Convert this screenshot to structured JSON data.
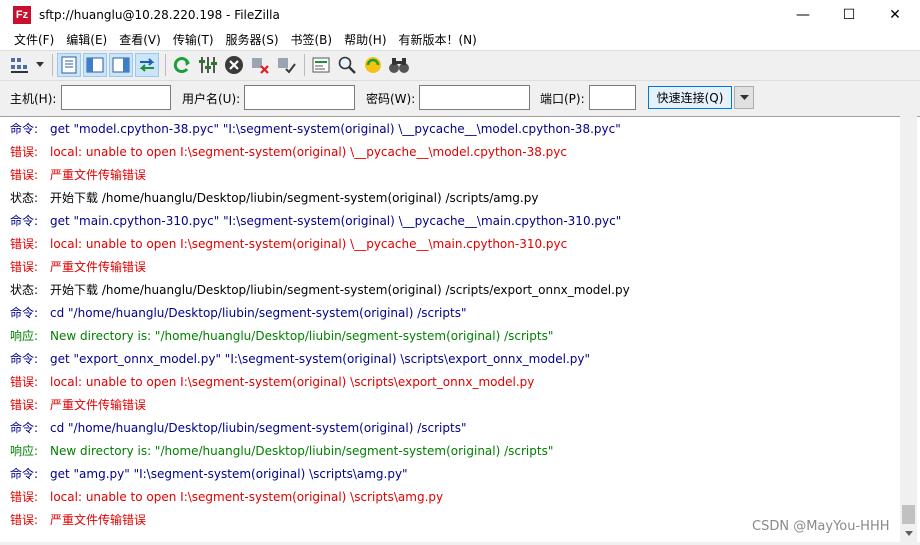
{
  "window": {
    "title": "sftp://huanglu@10.28.220.198 - FileZilla",
    "icon_letter": "Fz",
    "min_glyph": "—",
    "max_glyph": "☐",
    "close_glyph": "✕"
  },
  "menu": [
    "文件(F)",
    "编辑(E)",
    "查看(V)",
    "传输(T)",
    "服务器(S)",
    "书签(B)",
    "帮助(H)",
    "有新版本！(N)"
  ],
  "quickconnect": {
    "host_label": "主机(H):",
    "host_value": "",
    "user_label": "用户名(U):",
    "user_value": "",
    "pass_label": "密码(W):",
    "pass_value": "",
    "port_label": "端口(P):",
    "port_value": "",
    "connect_button": "快速连接(Q)"
  },
  "colors": {
    "command": "#00008b",
    "error": "#e00000",
    "status": "#000000",
    "response": "#008000"
  },
  "log": [
    {
      "type": "命令:",
      "kind": "command",
      "text": "get \"model.cpython-38.pyc\" \"I:\\segment-system(original) \\__pycache__\\model.cpython-38.pyc\""
    },
    {
      "type": "错误:",
      "kind": "error",
      "text": "local: unable to open I:\\segment-system(original) \\__pycache__\\model.cpython-38.pyc"
    },
    {
      "type": "错误:",
      "kind": "error",
      "text": "严重文件传输错误"
    },
    {
      "type": "状态:",
      "kind": "status",
      "text": "开始下载 /home/huanglu/Desktop/liubin/segment-system(original) /scripts/amg.py"
    },
    {
      "type": "命令:",
      "kind": "command",
      "text": "get \"main.cpython-310.pyc\" \"I:\\segment-system(original) \\__pycache__\\main.cpython-310.pyc\""
    },
    {
      "type": "错误:",
      "kind": "error",
      "text": "local: unable to open I:\\segment-system(original) \\__pycache__\\main.cpython-310.pyc"
    },
    {
      "type": "错误:",
      "kind": "error",
      "text": "严重文件传输错误"
    },
    {
      "type": "状态:",
      "kind": "status",
      "text": "开始下载 /home/huanglu/Desktop/liubin/segment-system(original) /scripts/export_onnx_model.py"
    },
    {
      "type": "命令:",
      "kind": "command",
      "text": "cd \"/home/huanglu/Desktop/liubin/segment-system(original) /scripts\""
    },
    {
      "type": "响应:",
      "kind": "response",
      "text": "New directory is: \"/home/huanglu/Desktop/liubin/segment-system(original) /scripts\""
    },
    {
      "type": "命令:",
      "kind": "command",
      "text": "get \"export_onnx_model.py\" \"I:\\segment-system(original) \\scripts\\export_onnx_model.py\""
    },
    {
      "type": "错误:",
      "kind": "error",
      "text": "local: unable to open I:\\segment-system(original) \\scripts\\export_onnx_model.py"
    },
    {
      "type": "错误:",
      "kind": "error",
      "text": "严重文件传输错误"
    },
    {
      "type": "命令:",
      "kind": "command",
      "text": "cd \"/home/huanglu/Desktop/liubin/segment-system(original) /scripts\""
    },
    {
      "type": "响应:",
      "kind": "response",
      "text": "New directory is: \"/home/huanglu/Desktop/liubin/segment-system(original) /scripts\""
    },
    {
      "type": "命令:",
      "kind": "command",
      "text": "get \"amg.py\" \"I:\\segment-system(original) \\scripts\\amg.py\""
    },
    {
      "type": "错误:",
      "kind": "error",
      "text": "local: unable to open I:\\segment-system(original) \\scripts\\amg.py"
    },
    {
      "type": "错误:",
      "kind": "error",
      "text": "严重文件传输错误"
    }
  ],
  "watermark": "CSDN @MayYou-HHH"
}
